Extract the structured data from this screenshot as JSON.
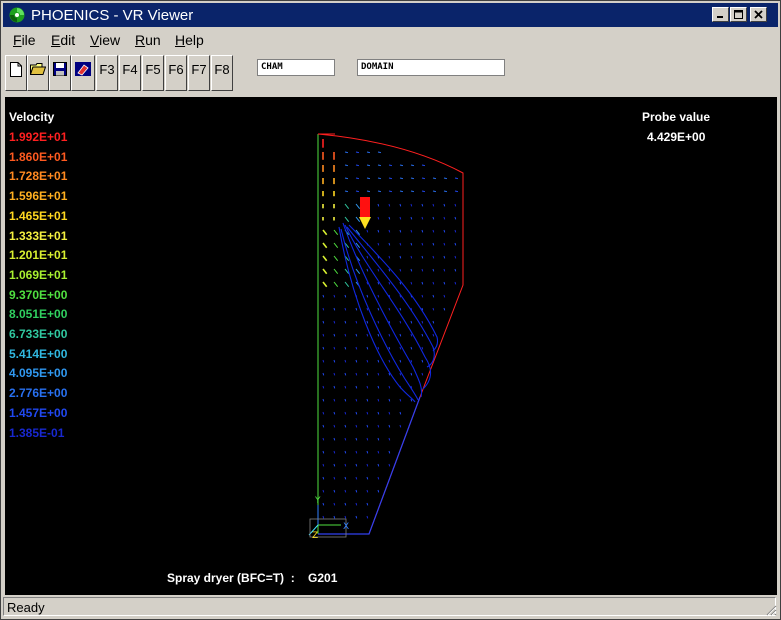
{
  "window": {
    "title": "PHOENICS - VR Viewer"
  },
  "menu": [
    {
      "label": "File",
      "u": "F",
      "rest": "ile"
    },
    {
      "label": "Edit",
      "u": "E",
      "rest": "dit"
    },
    {
      "label": "View",
      "u": "V",
      "rest": "iew"
    },
    {
      "label": "Run",
      "u": "R",
      "rest": "un"
    },
    {
      "label": "Help",
      "u": "H",
      "rest": "elp"
    }
  ],
  "toolbar": {
    "icons": [
      "new-file-icon",
      "open-folder-icon",
      "save-disk-icon",
      "eraser-icon"
    ],
    "fkeys": [
      "F3",
      "F4",
      "F5",
      "F6",
      "F7",
      "F8"
    ],
    "field1": "CHAM",
    "field2": "DOMAIN"
  },
  "legend": {
    "title": "Velocity",
    "items": [
      {
        "value": "1.992E+01",
        "color": "#ff2020"
      },
      {
        "value": "1.860E+01",
        "color": "#ff5a20"
      },
      {
        "value": "1.728E+01",
        "color": "#ff8a20"
      },
      {
        "value": "1.596E+01",
        "color": "#ffb020"
      },
      {
        "value": "1.465E+01",
        "color": "#ffd820"
      },
      {
        "value": "1.333E+01",
        "color": "#f4f040"
      },
      {
        "value": "1.201E+01",
        "color": "#d8f030"
      },
      {
        "value": "1.069E+01",
        "color": "#a8f030"
      },
      {
        "value": "9.370E+00",
        "color": "#50e040"
      },
      {
        "value": "8.051E+00",
        "color": "#30d060"
      },
      {
        "value": "6.733E+00",
        "color": "#30c8a0"
      },
      {
        "value": "5.414E+00",
        "color": "#30b8e0"
      },
      {
        "value": "4.095E+00",
        "color": "#3098f0"
      },
      {
        "value": "2.776E+00",
        "color": "#2870f0"
      },
      {
        "value": "1.457E+00",
        "color": "#2048f0"
      },
      {
        "value": "1.385E-01",
        "color": "#1828d0"
      }
    ]
  },
  "probe": {
    "label": "Probe value",
    "value": "4.429E+00"
  },
  "caption": "Spray dryer (BFC=T)  :    G201",
  "axis": {
    "x": "X",
    "y": "Y",
    "z": "Z"
  },
  "status": {
    "text": "Ready"
  }
}
